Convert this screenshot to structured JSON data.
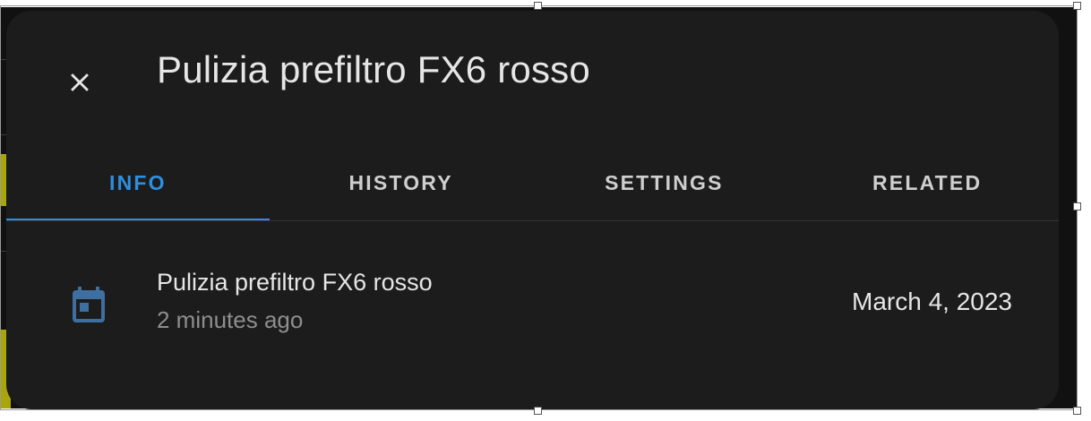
{
  "dialog": {
    "title": "Pulizia prefiltro FX6 rosso",
    "close_icon": "close-icon"
  },
  "tabs": [
    {
      "label": "INFO",
      "active": true
    },
    {
      "label": "HISTORY",
      "active": false
    },
    {
      "label": "SETTINGS",
      "active": false
    },
    {
      "label": "RELATED",
      "active": false
    }
  ],
  "event": {
    "icon": "calendar-icon",
    "title": "Pulizia prefiltro FX6 rosso",
    "relative_time": "2 minutes ago",
    "date": "March 4, 2023"
  },
  "colors": {
    "dialog_background": "#1c1c1c",
    "accent": "#2d8fe0",
    "icon": "#3f6fa0",
    "text_primary": "#e6e6e6",
    "text_secondary": "#8e8e8e"
  }
}
